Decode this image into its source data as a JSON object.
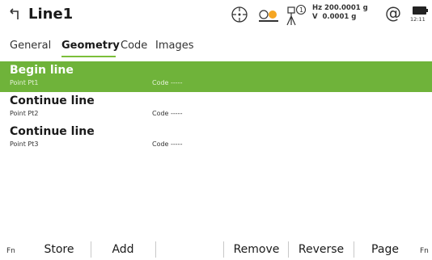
{
  "titlebar": {
    "title": "Line1",
    "hz_line": "Hz 200.0001 g",
    "v_line": "V  0.0001 g",
    "at_symbol": "@",
    "battery_time": "12:11",
    "icons": [
      "back-icon",
      "target-icon",
      "prism-icon",
      "instrument-icon",
      "at-icon",
      "battery-icon"
    ]
  },
  "tabs": [
    {
      "label": "General",
      "active": false
    },
    {
      "label": "Geometry",
      "active": true
    },
    {
      "label": "Code",
      "active": false
    },
    {
      "label": "Images",
      "active": false
    }
  ],
  "list": [
    {
      "title": "Begin line",
      "point": "Point  Pt1",
      "code": "Code  -----",
      "selected": true
    },
    {
      "title": "Continue line",
      "point": "Point  Pt2",
      "code": "Code  -----",
      "selected": false
    },
    {
      "title": "Continue line",
      "point": "Point  Pt3",
      "code": "Code  -----",
      "selected": false
    }
  ],
  "softkeys": {
    "fn_left": "Fn",
    "fn_right": "Fn",
    "keys": [
      "Store",
      "Add",
      "",
      "Remove",
      "Reverse",
      "Page"
    ]
  },
  "colors": {
    "selection": "#6fb33a",
    "tab_underline": "#7cbf3a"
  }
}
